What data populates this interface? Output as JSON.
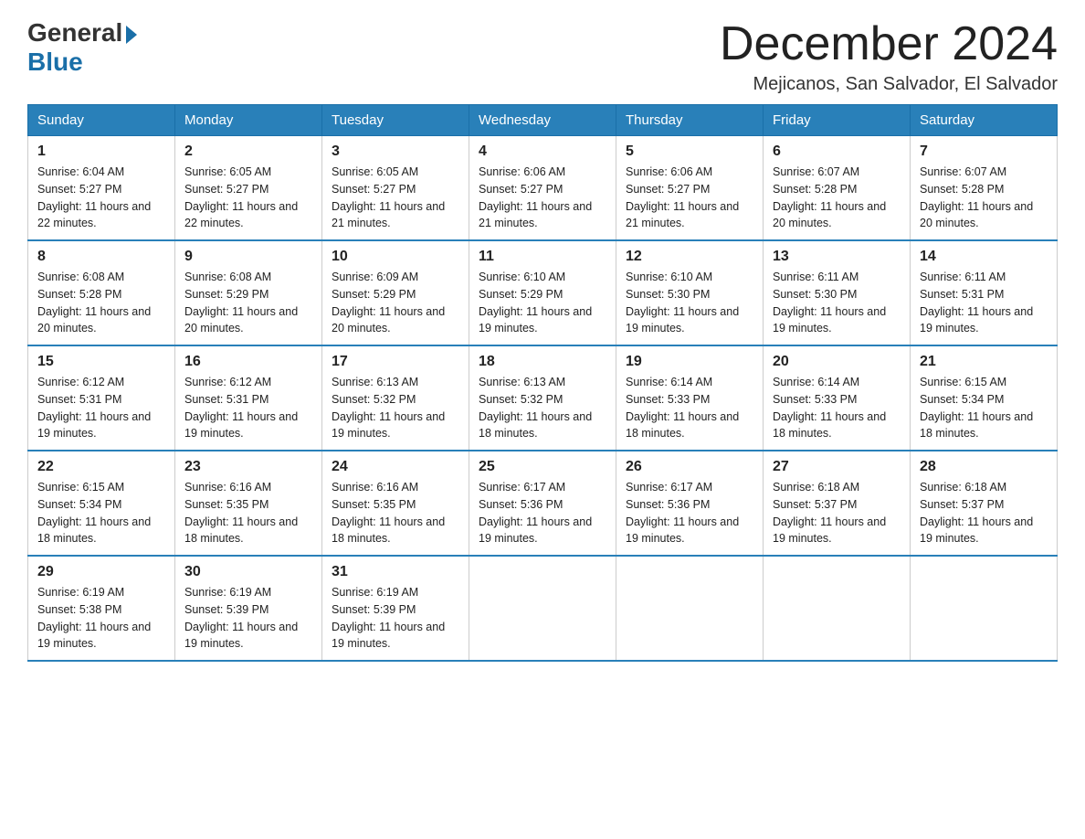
{
  "logo": {
    "general": "General",
    "blue": "Blue"
  },
  "title": "December 2024",
  "subtitle": "Mejicanos, San Salvador, El Salvador",
  "days_of_week": [
    "Sunday",
    "Monday",
    "Tuesday",
    "Wednesday",
    "Thursday",
    "Friday",
    "Saturday"
  ],
  "weeks": [
    [
      {
        "day": "1",
        "sunrise": "6:04 AM",
        "sunset": "5:27 PM",
        "daylight": "11 hours and 22 minutes."
      },
      {
        "day": "2",
        "sunrise": "6:05 AM",
        "sunset": "5:27 PM",
        "daylight": "11 hours and 22 minutes."
      },
      {
        "day": "3",
        "sunrise": "6:05 AM",
        "sunset": "5:27 PM",
        "daylight": "11 hours and 21 minutes."
      },
      {
        "day": "4",
        "sunrise": "6:06 AM",
        "sunset": "5:27 PM",
        "daylight": "11 hours and 21 minutes."
      },
      {
        "day": "5",
        "sunrise": "6:06 AM",
        "sunset": "5:27 PM",
        "daylight": "11 hours and 21 minutes."
      },
      {
        "day": "6",
        "sunrise": "6:07 AM",
        "sunset": "5:28 PM",
        "daylight": "11 hours and 20 minutes."
      },
      {
        "day": "7",
        "sunrise": "6:07 AM",
        "sunset": "5:28 PM",
        "daylight": "11 hours and 20 minutes."
      }
    ],
    [
      {
        "day": "8",
        "sunrise": "6:08 AM",
        "sunset": "5:28 PM",
        "daylight": "11 hours and 20 minutes."
      },
      {
        "day": "9",
        "sunrise": "6:08 AM",
        "sunset": "5:29 PM",
        "daylight": "11 hours and 20 minutes."
      },
      {
        "day": "10",
        "sunrise": "6:09 AM",
        "sunset": "5:29 PM",
        "daylight": "11 hours and 20 minutes."
      },
      {
        "day": "11",
        "sunrise": "6:10 AM",
        "sunset": "5:29 PM",
        "daylight": "11 hours and 19 minutes."
      },
      {
        "day": "12",
        "sunrise": "6:10 AM",
        "sunset": "5:30 PM",
        "daylight": "11 hours and 19 minutes."
      },
      {
        "day": "13",
        "sunrise": "6:11 AM",
        "sunset": "5:30 PM",
        "daylight": "11 hours and 19 minutes."
      },
      {
        "day": "14",
        "sunrise": "6:11 AM",
        "sunset": "5:31 PM",
        "daylight": "11 hours and 19 minutes."
      }
    ],
    [
      {
        "day": "15",
        "sunrise": "6:12 AM",
        "sunset": "5:31 PM",
        "daylight": "11 hours and 19 minutes."
      },
      {
        "day": "16",
        "sunrise": "6:12 AM",
        "sunset": "5:31 PM",
        "daylight": "11 hours and 19 minutes."
      },
      {
        "day": "17",
        "sunrise": "6:13 AM",
        "sunset": "5:32 PM",
        "daylight": "11 hours and 19 minutes."
      },
      {
        "day": "18",
        "sunrise": "6:13 AM",
        "sunset": "5:32 PM",
        "daylight": "11 hours and 18 minutes."
      },
      {
        "day": "19",
        "sunrise": "6:14 AM",
        "sunset": "5:33 PM",
        "daylight": "11 hours and 18 minutes."
      },
      {
        "day": "20",
        "sunrise": "6:14 AM",
        "sunset": "5:33 PM",
        "daylight": "11 hours and 18 minutes."
      },
      {
        "day": "21",
        "sunrise": "6:15 AM",
        "sunset": "5:34 PM",
        "daylight": "11 hours and 18 minutes."
      }
    ],
    [
      {
        "day": "22",
        "sunrise": "6:15 AM",
        "sunset": "5:34 PM",
        "daylight": "11 hours and 18 minutes."
      },
      {
        "day": "23",
        "sunrise": "6:16 AM",
        "sunset": "5:35 PM",
        "daylight": "11 hours and 18 minutes."
      },
      {
        "day": "24",
        "sunrise": "6:16 AM",
        "sunset": "5:35 PM",
        "daylight": "11 hours and 18 minutes."
      },
      {
        "day": "25",
        "sunrise": "6:17 AM",
        "sunset": "5:36 PM",
        "daylight": "11 hours and 19 minutes."
      },
      {
        "day": "26",
        "sunrise": "6:17 AM",
        "sunset": "5:36 PM",
        "daylight": "11 hours and 19 minutes."
      },
      {
        "day": "27",
        "sunrise": "6:18 AM",
        "sunset": "5:37 PM",
        "daylight": "11 hours and 19 minutes."
      },
      {
        "day": "28",
        "sunrise": "6:18 AM",
        "sunset": "5:37 PM",
        "daylight": "11 hours and 19 minutes."
      }
    ],
    [
      {
        "day": "29",
        "sunrise": "6:19 AM",
        "sunset": "5:38 PM",
        "daylight": "11 hours and 19 minutes."
      },
      {
        "day": "30",
        "sunrise": "6:19 AM",
        "sunset": "5:39 PM",
        "daylight": "11 hours and 19 minutes."
      },
      {
        "day": "31",
        "sunrise": "6:19 AM",
        "sunset": "5:39 PM",
        "daylight": "11 hours and 19 minutes."
      },
      null,
      null,
      null,
      null
    ]
  ]
}
